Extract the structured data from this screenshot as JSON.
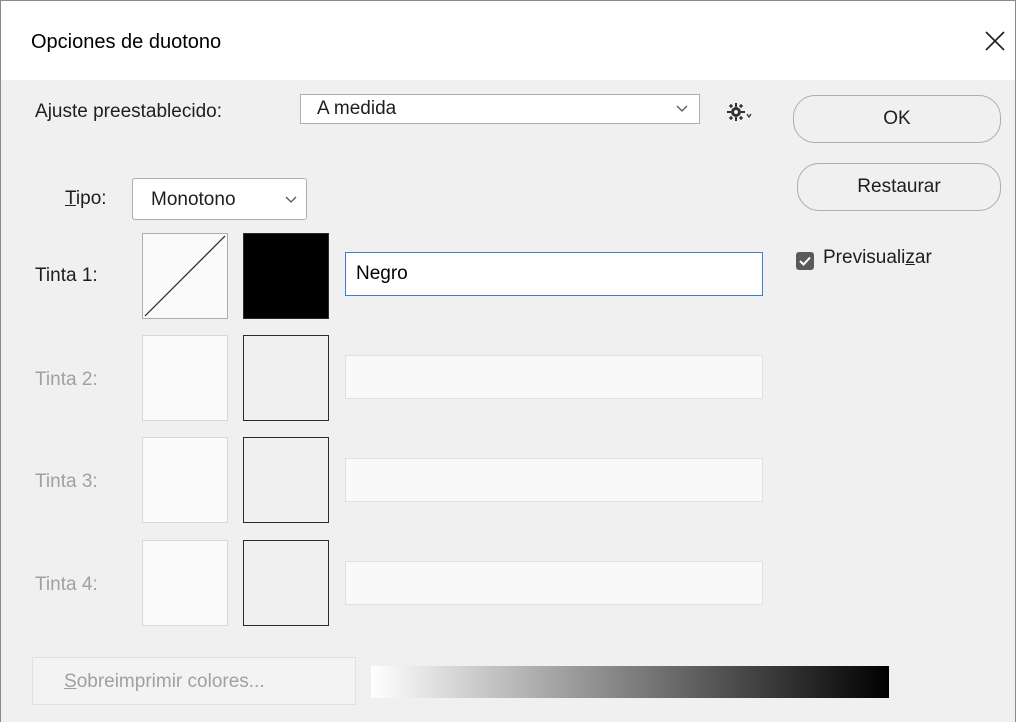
{
  "window": {
    "title": "Opciones de duotono",
    "close_icon": "close-icon"
  },
  "preset": {
    "label_pre": "A",
    "label_underlined": "j",
    "label_post": "uste preestablecido:",
    "value": "A medida",
    "settings_icon": "gear-icon"
  },
  "type": {
    "label_underlined": "T",
    "label_post": "ipo:",
    "value": "Monotono"
  },
  "inks": [
    {
      "label": "Tinta 1:",
      "name": "Negro",
      "enabled": true,
      "color": "#000000"
    },
    {
      "label": "Tinta 2:",
      "name": "",
      "enabled": false,
      "color": ""
    },
    {
      "label": "Tinta 3:",
      "name": "",
      "enabled": false,
      "color": ""
    },
    {
      "label": "Tinta 4:",
      "name": "",
      "enabled": false,
      "color": ""
    }
  ],
  "buttons": {
    "ok": "OK",
    "reset": "Restaurar"
  },
  "preview": {
    "label_pre": "Previsuali",
    "label_underlined": "z",
    "label_post": "ar",
    "checked": true
  },
  "overprint": {
    "label_underlined": "S",
    "label_post": "obreimprimir colores..."
  },
  "colors": {
    "focus_border": "#3c7bd6",
    "disabled_text": "#a0a0a0"
  }
}
